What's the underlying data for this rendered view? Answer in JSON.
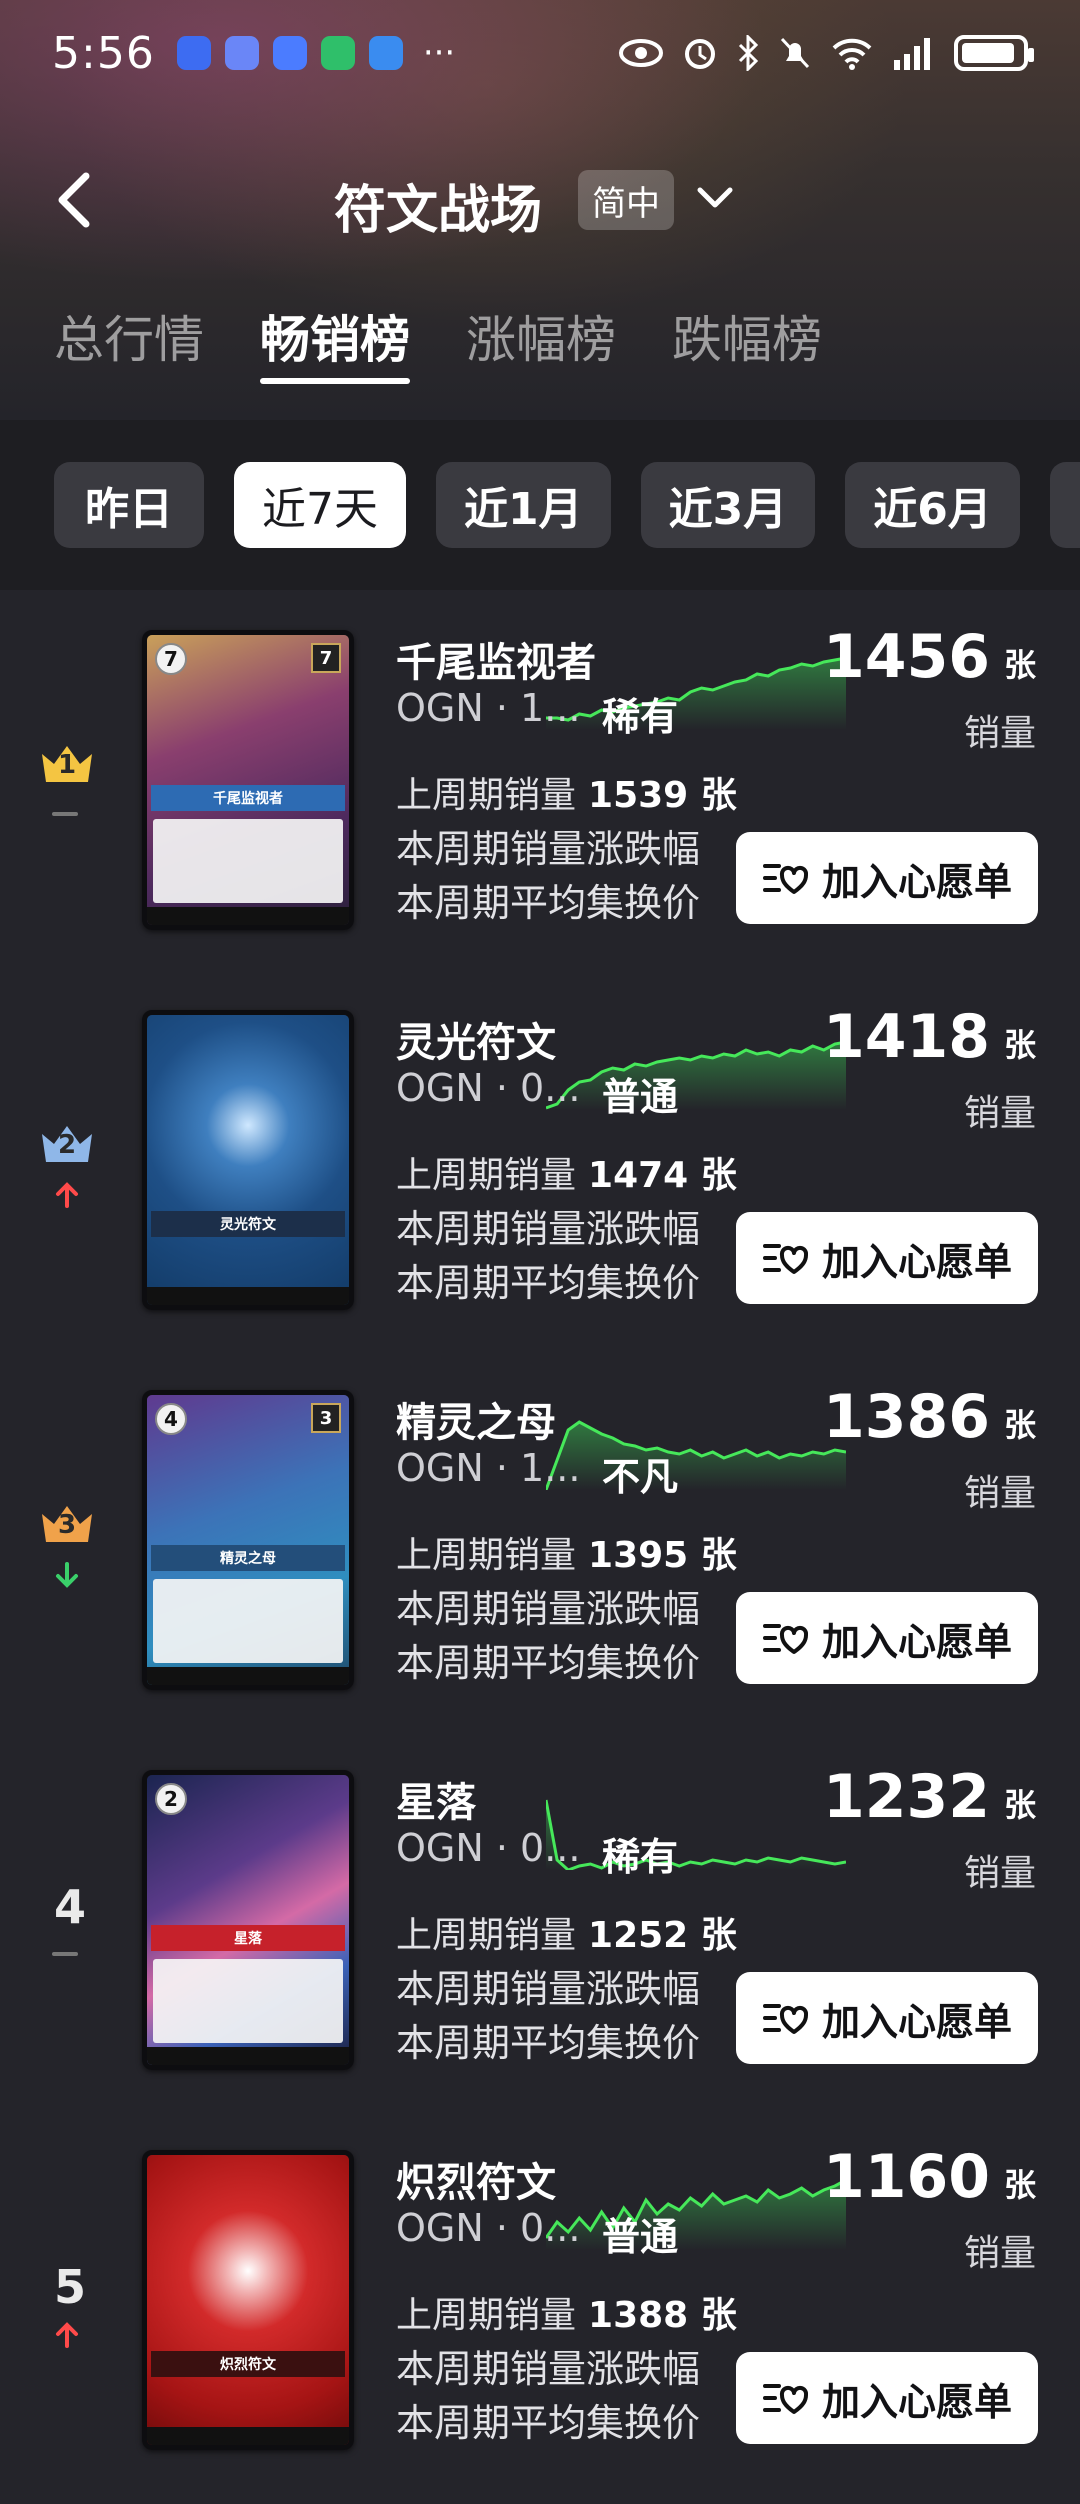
{
  "status_bar": {
    "time": "5:56",
    "more": "···",
    "app_colors": [
      "#3d6cf2",
      "#6a86f7",
      "#4b7cff",
      "#2fbf6a",
      "#3a8cf0"
    ]
  },
  "header": {
    "title": "符文战场",
    "lang": "简中"
  },
  "tabs": [
    {
      "label": "总行情",
      "active": false
    },
    {
      "label": "畅销榜",
      "active": true
    },
    {
      "label": "涨幅榜",
      "active": false
    },
    {
      "label": "跌幅榜",
      "active": false
    }
  ],
  "filters": [
    {
      "label": "昨日",
      "active": false
    },
    {
      "label": "近7天",
      "active": true
    },
    {
      "label": "近1月",
      "active": false
    },
    {
      "label": "近3月",
      "active": false
    },
    {
      "label": "近6月",
      "active": false
    },
    {
      "label": "近",
      "active": false
    }
  ],
  "labels": {
    "sales_unit": "张",
    "sales_label": "销量",
    "last_week": "上周期销量",
    "change": "本周期销量涨跌幅",
    "avg": "本周期平均集换价",
    "wish": "加入心愿单"
  },
  "items": [
    {
      "rank": "1",
      "trend": "flat",
      "name": "千尾监视者",
      "set": "OGN · 1...",
      "rarity": "稀有",
      "sales": "1456",
      "last_week": "1539 张",
      "card_cost": "7",
      "card_might": "7",
      "card_title": "千尾监视者",
      "theme": "purple-gold"
    },
    {
      "rank": "2",
      "trend": "up",
      "name": "灵光符文",
      "set": "OGN · 0...",
      "rarity": "普通",
      "sales": "1418",
      "last_week": "1474 张",
      "card_cost": "",
      "card_might": "",
      "card_title": "灵光符文",
      "theme": "blue"
    },
    {
      "rank": "3",
      "trend": "down",
      "name": "精灵之母",
      "set": "OGN · 1...",
      "rarity": "不凡",
      "sales": "1386",
      "last_week": "1395 张",
      "card_cost": "4",
      "card_might": "3",
      "card_title": "精灵之母",
      "theme": "teal"
    },
    {
      "rank": "4",
      "trend": "flat",
      "name": "星落",
      "set": "OGN · 0...",
      "rarity": "稀有",
      "sales": "1232",
      "last_week": "1252 张",
      "card_cost": "2",
      "card_might": "",
      "card_title": "星落",
      "theme": "cosmic"
    },
    {
      "rank": "5",
      "trend": "up",
      "name": "炽烈符文",
      "set": "OGN · 0...",
      "rarity": "普通",
      "sales": "1160",
      "last_week": "1388 张",
      "card_cost": "",
      "card_might": "",
      "card_title": "炽烈符文",
      "theme": "red"
    }
  ]
}
